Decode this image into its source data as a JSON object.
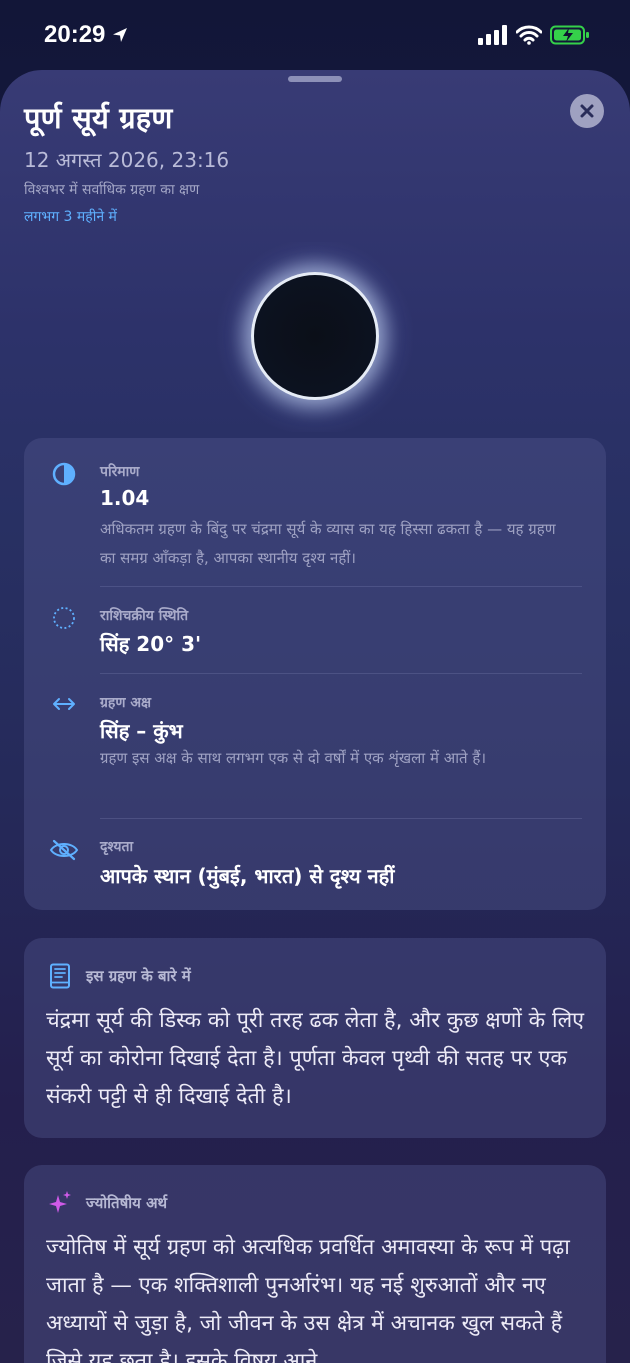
{
  "status_bar": {
    "time": "20:29"
  },
  "header": {
    "title": "पूर्ण सूर्य ग्रहण",
    "date": "12 अगस्त 2026, 23:16",
    "subtitle": "विश्वभर में सर्वाधिक ग्रहण का क्षण",
    "eta": "लगभग 3 महीने में"
  },
  "details": {
    "magnitude": {
      "label": "परिमाण",
      "value": "1.04",
      "desc": "अधिकतम ग्रहण के बिंदु पर चंद्रमा सूर्य के व्यास का यह हिस्सा ढकता है — यह ग्रहण का समग्र आँकड़ा है, आपका स्थानीय दृश्य नहीं।"
    },
    "zodiac": {
      "label": "राशिचक्रीय स्थिति",
      "value": "सिंह 20° 3'"
    },
    "axis": {
      "label": "ग्रहण अक्ष",
      "value": "सिंह – कुंभ",
      "desc": "ग्रहण इस अक्ष के साथ लगभग एक से दो वर्षों में एक शृंखला में आते हैं।"
    },
    "visibility": {
      "label": "दृश्यता",
      "value": "आपके स्थान (मुंबई, भारत) से दृश्य नहीं"
    }
  },
  "about": {
    "title": "इस ग्रहण के बारे में",
    "body": "चंद्रमा सूर्य की डिस्क को पूरी तरह ढक लेता है, और कुछ क्षणों के लिए सूर्य का कोरोना दिखाई देता है। पूर्णता केवल पृथ्वी की सतह पर एक संकरी पट्टी से ही दिखाई देती है।"
  },
  "astrology": {
    "title": "ज्योतिषीय अर्थ",
    "body": "ज्योतिष में सूर्य ग्रहण को अत्यधिक प्रवर्धित अमावस्या के रूप में पढ़ा जाता है — एक शक्तिशाली पुनर्आरंभ। यह नई शुरुआतों और नए अध्यायों से जुड़ा है, जो जीवन के उस क्षेत्र में अचानक खुल सकते हैं जिसे यह छूता है। इसके विषय आने"
  },
  "colors": {
    "accent_blue": "#5fb0ff",
    "accent_magenta": "#d05ae8",
    "battery_green": "#35d14a"
  },
  "icons": {
    "magnitude": "half-circle-icon",
    "zodiac": "dotted-circle-icon",
    "axis": "left-right-arrow-icon",
    "visibility": "eye-slash-icon",
    "about": "book-icon",
    "astrology": "sparkles-icon"
  }
}
